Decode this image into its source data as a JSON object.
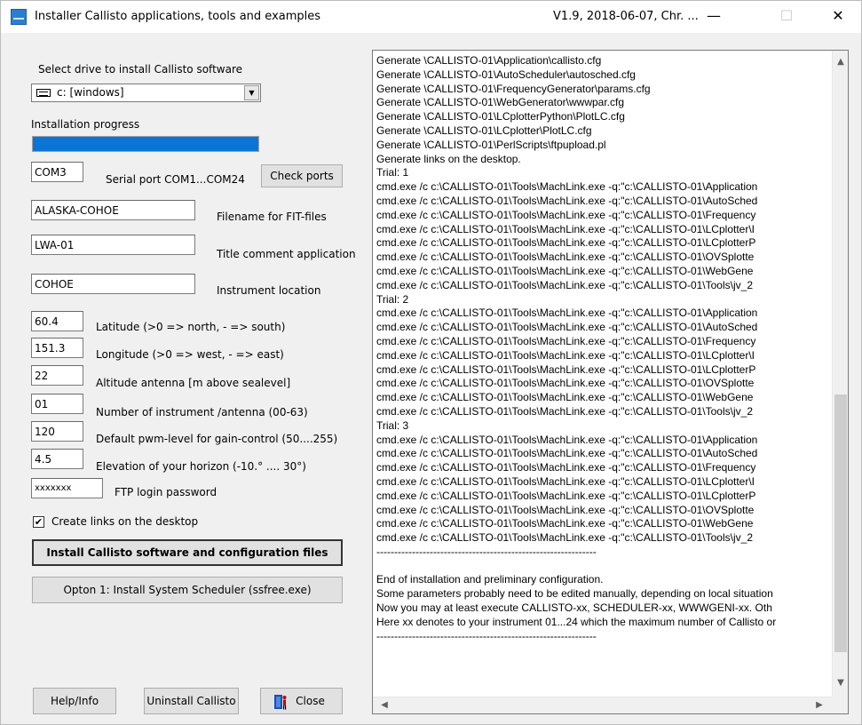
{
  "window": {
    "title": "Installer Callisto applications, tools and examples",
    "version_text": "V1.9, 2018-06-07, Chr. ...",
    "minimize": "—",
    "maximize": "☐",
    "close": "✕"
  },
  "drive": {
    "label": "Select drive to install Callisto software",
    "selected": "c: [windows]",
    "icon": "drive-icon"
  },
  "progress": {
    "label": "Installation progress",
    "value": 1.0,
    "color": "#0b75d6"
  },
  "fields": {
    "serial_port": {
      "value": "COM3",
      "label": "Serial port COM1...COM24"
    },
    "filename": {
      "value": "ALASKA-COHOE",
      "label": "Filename for FIT-files"
    },
    "title_comment": {
      "value": "LWA-01",
      "label": "Title comment application"
    },
    "location": {
      "value": "COHOE",
      "label": "Instrument location"
    },
    "latitude": {
      "value": "60.4",
      "label": "Latitude (>0 => north, - => south)"
    },
    "longitude": {
      "value": "151.3",
      "label": "Longitude (>0 => west, - => east)"
    },
    "altitude": {
      "value": "22",
      "label": "Altitude antenna [m above sealevel]"
    },
    "instrument_number": {
      "value": "01",
      "label": "Number of instrument /antenna (00-63)"
    },
    "pwm_level": {
      "value": "120",
      "label": "Default pwm-level for gain-control  (50....255)"
    },
    "horizon": {
      "value": "4.5",
      "label": "Elevation of your horizon (-10.° .... 30°)"
    },
    "ftp_password": {
      "value": "xxxxxxx",
      "label": "FTP login password"
    }
  },
  "buttons": {
    "check_ports": "Check ports",
    "install": "Install Callisto software and configuration files",
    "option1": "Opton 1: Install System Scheduler (ssfree.exe)",
    "help": "Help/Info",
    "uninstall": "Uninstall Callisto",
    "close": "Close"
  },
  "checkbox": {
    "label": "Create links on the desktop",
    "checked": true,
    "mark": "✔"
  },
  "log": {
    "lines": [
      "Generate \\CALLISTO-01\\Application\\callisto.cfg",
      "Generate \\CALLISTO-01\\AutoScheduler\\autosched.cfg",
      "Generate \\CALLISTO-01\\FrequencyGenerator\\params.cfg",
      "Generate \\CALLISTO-01\\WebGenerator\\wwwpar.cfg",
      "Generate \\CALLISTO-01\\LCplotterPython\\PlotLC.cfg",
      "Generate \\CALLISTO-01\\LCplotter\\PlotLC.cfg",
      "Generate \\CALLISTO-01\\PerlScripts\\ftpupload.pl",
      "Generate links on the desktop.",
      "Trial: 1",
      "cmd.exe /c c:\\CALLISTO-01\\Tools\\MachLink.exe -q:\"c:\\CALLISTO-01\\Application",
      "cmd.exe /c c:\\CALLISTO-01\\Tools\\MachLink.exe -q:\"c:\\CALLISTO-01\\AutoSched",
      "cmd.exe /c c:\\CALLISTO-01\\Tools\\MachLink.exe -q:\"c:\\CALLISTO-01\\Frequency",
      "cmd.exe /c c:\\CALLISTO-01\\Tools\\MachLink.exe -q:\"c:\\CALLISTO-01\\LCplotter\\I",
      "cmd.exe /c c:\\CALLISTO-01\\Tools\\MachLink.exe -q:\"c:\\CALLISTO-01\\LCplotterP",
      "cmd.exe /c c:\\CALLISTO-01\\Tools\\MachLink.exe -q:\"c:\\CALLISTO-01\\OVSplotte",
      "cmd.exe /c c:\\CALLISTO-01\\Tools\\MachLink.exe -q:\"c:\\CALLISTO-01\\WebGene",
      "cmd.exe /c c:\\CALLISTO-01\\Tools\\MachLink.exe -q:\"c:\\CALLISTO-01\\Tools\\jv_2",
      "Trial: 2",
      "cmd.exe /c c:\\CALLISTO-01\\Tools\\MachLink.exe -q:\"c:\\CALLISTO-01\\Application",
      "cmd.exe /c c:\\CALLISTO-01\\Tools\\MachLink.exe -q:\"c:\\CALLISTO-01\\AutoSched",
      "cmd.exe /c c:\\CALLISTO-01\\Tools\\MachLink.exe -q:\"c:\\CALLISTO-01\\Frequency",
      "cmd.exe /c c:\\CALLISTO-01\\Tools\\MachLink.exe -q:\"c:\\CALLISTO-01\\LCplotter\\I",
      "cmd.exe /c c:\\CALLISTO-01\\Tools\\MachLink.exe -q:\"c:\\CALLISTO-01\\LCplotterP",
      "cmd.exe /c c:\\CALLISTO-01\\Tools\\MachLink.exe -q:\"c:\\CALLISTO-01\\OVSplotte",
      "cmd.exe /c c:\\CALLISTO-01\\Tools\\MachLink.exe -q:\"c:\\CALLISTO-01\\WebGene",
      "cmd.exe /c c:\\CALLISTO-01\\Tools\\MachLink.exe -q:\"c:\\CALLISTO-01\\Tools\\jv_2",
      "Trial: 3",
      "cmd.exe /c c:\\CALLISTO-01\\Tools\\MachLink.exe -q:\"c:\\CALLISTO-01\\Application",
      "cmd.exe /c c:\\CALLISTO-01\\Tools\\MachLink.exe -q:\"c:\\CALLISTO-01\\AutoSched",
      "cmd.exe /c c:\\CALLISTO-01\\Tools\\MachLink.exe -q:\"c:\\CALLISTO-01\\Frequency",
      "cmd.exe /c c:\\CALLISTO-01\\Tools\\MachLink.exe -q:\"c:\\CALLISTO-01\\LCplotter\\I",
      "cmd.exe /c c:\\CALLISTO-01\\Tools\\MachLink.exe -q:\"c:\\CALLISTO-01\\LCplotterP",
      "cmd.exe /c c:\\CALLISTO-01\\Tools\\MachLink.exe -q:\"c:\\CALLISTO-01\\OVSplotte",
      "cmd.exe /c c:\\CALLISTO-01\\Tools\\MachLink.exe -q:\"c:\\CALLISTO-01\\WebGene",
      "cmd.exe /c c:\\CALLISTO-01\\Tools\\MachLink.exe -q:\"c:\\CALLISTO-01\\Tools\\jv_2",
      "--------------------------------------------------------------",
      "",
      "End of installation and preliminary configuration.",
      "Some parameters probably need to be edited manually, depending on local situation",
      "Now you may at least execute CALLISTO-xx, SCHEDULER-xx, WWWGENI-xx. Oth",
      "Here xx denotes to your instrument 01...24 which the maximum number of Callisto or",
      "--------------------------------------------------------------"
    ]
  },
  "icons": {
    "scroll_up": "▲",
    "scroll_down": "▼",
    "scroll_left": "◀",
    "scroll_right": "▶",
    "close_button_icon": "door-person-icon"
  }
}
